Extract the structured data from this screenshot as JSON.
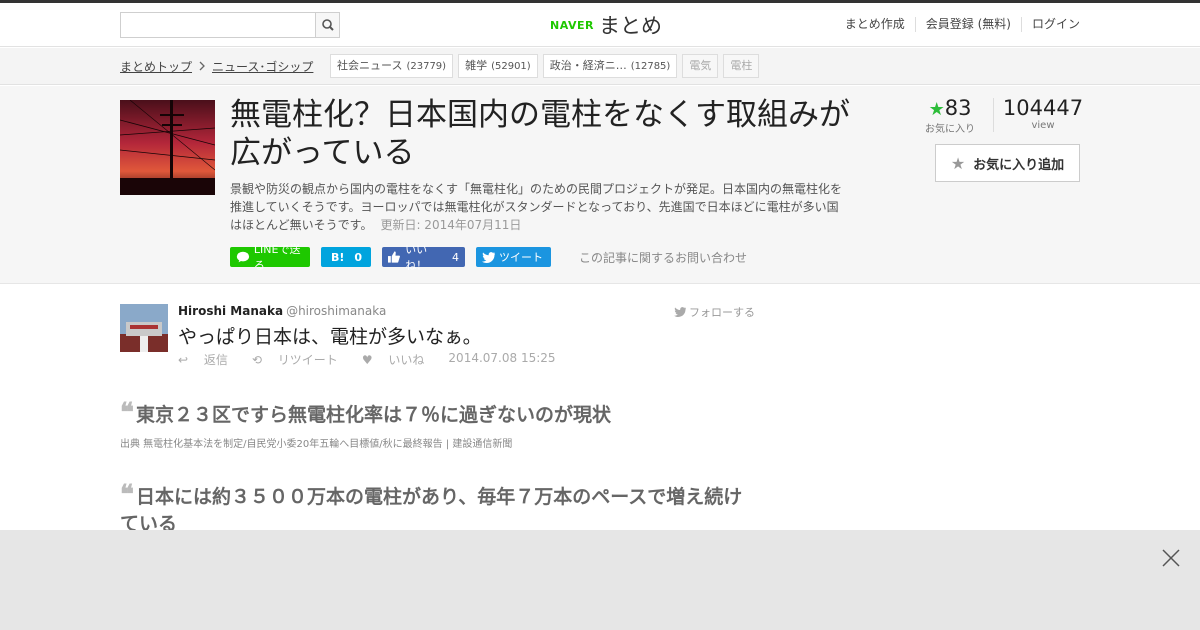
{
  "header": {
    "search": {
      "value": "",
      "placeholder": "",
      "button_icon": "search-icon"
    },
    "logo": {
      "naver": "NAVER",
      "name": "まとめ"
    },
    "nav": [
      "まとめ作成",
      "会員登録 (無料)",
      "ログイン"
    ]
  },
  "breadcrumb": {
    "items": [
      "まとめトップ",
      "ニュース･ゴシップ"
    ],
    "tags": [
      {
        "label": "社会ニュース",
        "count": "(23779)"
      },
      {
        "label": "雑学",
        "count": "(52901)"
      },
      {
        "label": "政治・経済ニ…",
        "count": "(12785)"
      },
      {
        "label": "電気",
        "count": ""
      },
      {
        "label": "電柱",
        "count": ""
      }
    ]
  },
  "article": {
    "title": "無電柱化？日本国内の電柱をなくす取組みが広がっている",
    "description": "景観や防災の観点から国内の電柱をなくす「無電柱化」のための民間プロジェクトが発足。日本国内の無電柱化を推進していくそうです。ヨーロッパでは無電柱化がスタンダードとなっており、先進国で日本ほどに電柱が多い国はほとんど無いそうです。",
    "updated": "更新日: 2014年07月11日",
    "share": {
      "line": "LINEで送る",
      "hatena": "B!",
      "hatena_count": "0",
      "fb": "いいね！",
      "fb_count": "4",
      "tweet": "ツイート",
      "inquiry": "この記事に関するお問い合わせ"
    },
    "stats": {
      "favorites": "83",
      "favorites_label": "お気に入り",
      "views": "104447",
      "views_label": "view",
      "add_favorite": "お気に入り追加"
    }
  },
  "tweet": {
    "name": "Hiroshi Manaka",
    "handle": "@hiroshimanaka",
    "follow": "フォローする",
    "text": "やっぱり日本は、電柱が多いなぁ。",
    "actions": {
      "reply": "返信",
      "retweet": "リツイート",
      "like": "いいね",
      "timestamp": "2014.07.08 15:25"
    }
  },
  "quotes": [
    {
      "mark": "❝",
      "title": "東京２３区ですら無電柱化率は７％に過ぎないのが現状",
      "source": "出典  無電柱化基本法を制定/自民党小委20年五輪へ目標値/秋に最終報告 | 建設通信新聞"
    },
    {
      "mark": "❝",
      "title": "日本には約３５００万本の電柱があり、毎年７万本のペースで増え続けている",
      "source": ""
    }
  ],
  "overlay": {
    "close_icon": "close-icon"
  },
  "colors": {
    "brand_green": "#1ec800",
    "line": "#1ec800",
    "hatena": "#00a4de",
    "facebook": "#4267b2",
    "twitter": "#1b95e0",
    "fav_star": "#2dbd3a"
  }
}
